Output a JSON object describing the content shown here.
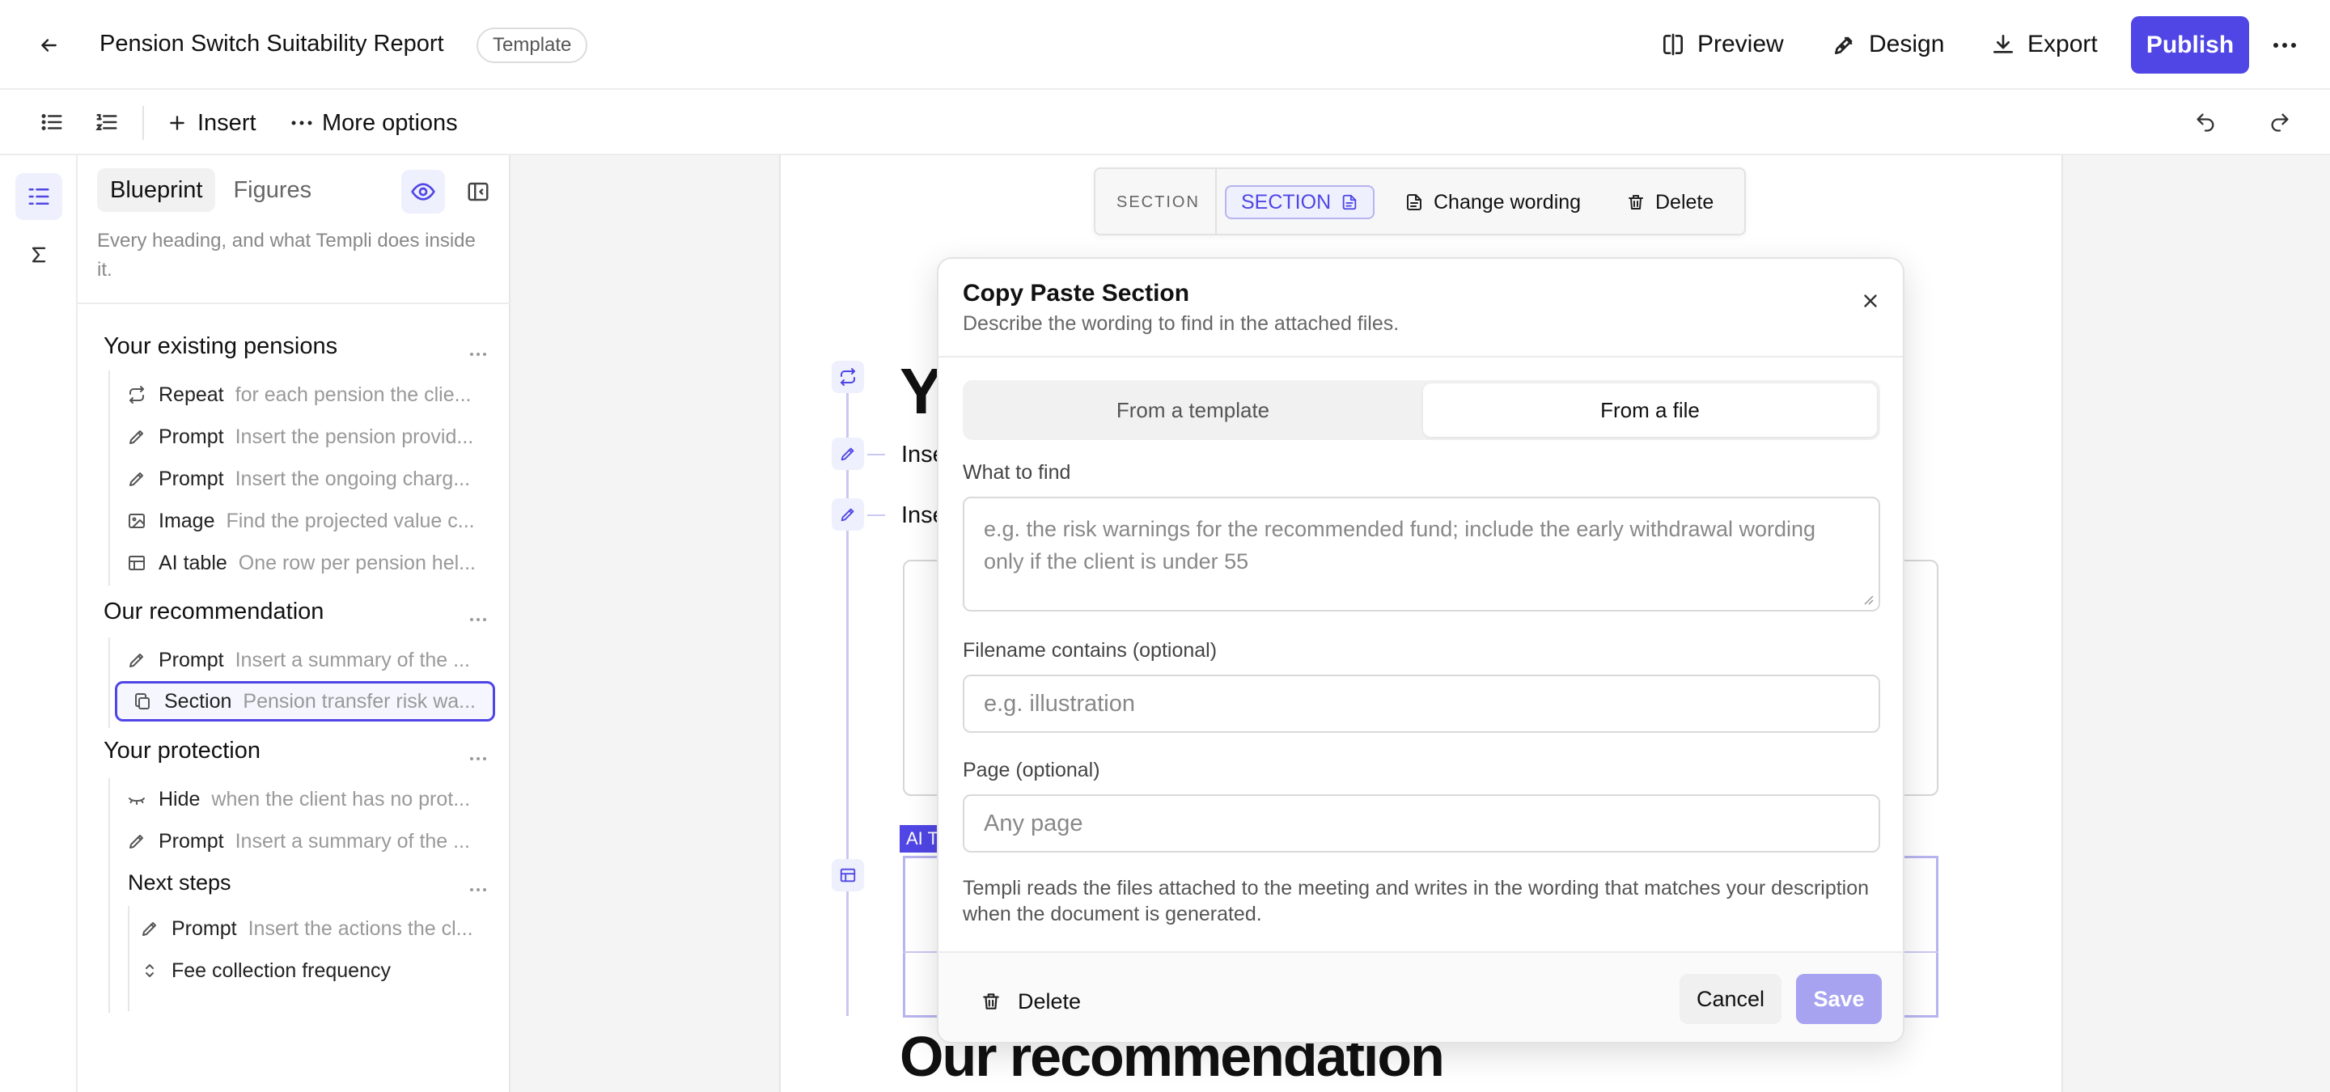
{
  "app": {
    "title": "Pension Switch Suitability Report",
    "badge": "Template",
    "actions": {
      "preview": "Preview",
      "design": "Design",
      "export": "Export",
      "publish": "Publish"
    },
    "accent": "#4f46e5"
  },
  "toolbar": {
    "insert": "Insert",
    "more_options": "More options"
  },
  "panel": {
    "tabs": [
      {
        "label": "Blueprint",
        "active": true
      },
      {
        "label": "Figures",
        "active": false
      }
    ],
    "description": "Every heading, and what Templi does inside it.",
    "sections": [
      {
        "heading": "Your existing pensions",
        "items": [
          {
            "icon": "repeat-icon",
            "kind": "Repeat",
            "desc": "for each pension the clie..."
          },
          {
            "icon": "pencil-icon",
            "kind": "Prompt",
            "desc": "Insert the pension provid..."
          },
          {
            "icon": "pencil-icon",
            "kind": "Prompt",
            "desc": "Insert the ongoing charg..."
          },
          {
            "icon": "image-icon",
            "kind": "Image",
            "desc": "Find the projected value c..."
          },
          {
            "icon": "table-icon",
            "kind": "AI table",
            "desc": "One row per pension hel..."
          }
        ]
      },
      {
        "heading": "Our recommendation",
        "items": [
          {
            "icon": "pencil-icon",
            "kind": "Prompt",
            "desc": "Insert a summary of the ..."
          },
          {
            "icon": "copy-icon",
            "kind": "Section",
            "desc": "Pension transfer risk wa...",
            "selected": true
          }
        ]
      },
      {
        "heading": "Your protection",
        "items": [
          {
            "icon": "eye-closed-icon",
            "kind": "Hide",
            "desc": "when the client has no prot..."
          },
          {
            "icon": "pencil-icon",
            "kind": "Prompt",
            "desc": "Insert a summary of the ..."
          }
        ]
      },
      {
        "heading": "Next steps",
        "items": [
          {
            "icon": "pencil-icon",
            "kind": "Prompt",
            "desc": "Insert the actions the cl..."
          },
          {
            "icon": "chevron-updown-icon",
            "kind": "Fee collection frequency",
            "desc": ""
          }
        ]
      }
    ]
  },
  "section_bar": {
    "label": "SECTION",
    "chip": "SECTION",
    "change_wording": "Change wording",
    "delete": "Delete"
  },
  "document": {
    "big_heading_partial": "Y",
    "insert_1": "Inse",
    "insert_2": "Inse",
    "ai_tag": "AI T",
    "heading2": "Our recommendation"
  },
  "modal": {
    "title": "Copy Paste Section",
    "subtitle": "Describe the wording to find in the attached files.",
    "tabs": [
      {
        "label": "From a template",
        "active": false
      },
      {
        "label": "From a file",
        "active": true
      }
    ],
    "what_to_find_label": "What to find",
    "what_to_find_placeholder": "e.g. the risk warnings for the recommended fund; include the early withdrawal wording only if the client is under 55",
    "filename_label": "Filename contains (optional)",
    "filename_placeholder": "e.g. illustration",
    "page_label": "Page (optional)",
    "page_placeholder": "Any page",
    "note": "Templi reads the files attached to the meeting and writes in the wording that matches your description when the document is generated.",
    "delete": "Delete",
    "cancel": "Cancel",
    "save": "Save"
  }
}
